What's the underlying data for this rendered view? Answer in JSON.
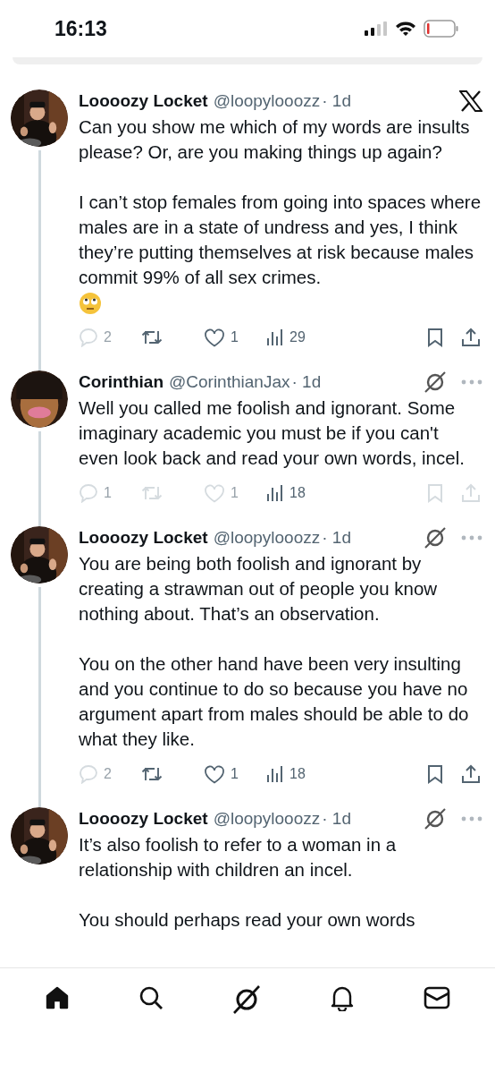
{
  "status_bar": {
    "time": "16:13"
  },
  "tweets": [
    {
      "name": "Loooozy Locket",
      "handle": "@loopylooozz",
      "time": "· 1d",
      "avatar": {
        "kind": "suit"
      },
      "badge": {
        "kind": "x_logo"
      },
      "more_menu": false,
      "paragraphs": [
        {
          "kind": "text",
          "text": "Can you show me which of my words are insults please? Or, are you making things up again?"
        },
        {
          "kind": "text",
          "text": "I can’t stop females from going into spaces where males are in a state of undress and yes, I think they’re putting themselves at risk because males commit 99% of all sex crimes."
        },
        {
          "kind": "emoji"
        }
      ],
      "actions": [
        {
          "kind": "reply",
          "count": "2",
          "disabled": true
        },
        {
          "kind": "repost",
          "disabled": false
        },
        {
          "kind": "like",
          "count": "1",
          "disabled": false
        },
        {
          "kind": "views",
          "count": "29",
          "disabled": false
        },
        {
          "kind": "bookmark",
          "disabled": false
        },
        {
          "kind": "share",
          "disabled": false
        }
      ]
    },
    {
      "name": "Corinthian",
      "handle": "@CorinthianJax",
      "time": "· 1d",
      "avatar": {
        "kind": "cartoon"
      },
      "badge": {
        "kind": "grok"
      },
      "more_menu": true,
      "paragraphs": [
        {
          "kind": "text",
          "text": "Well you called me foolish and ignorant. Some imaginary academic you must be if you can't even look back and read your own words, incel."
        }
      ],
      "actions": [
        {
          "kind": "reply",
          "count": "1",
          "disabled": true
        },
        {
          "kind": "repost",
          "disabled": true
        },
        {
          "kind": "like",
          "count": "1",
          "disabled": true
        },
        {
          "kind": "views",
          "count": "18",
          "disabled": false
        },
        {
          "kind": "bookmark",
          "disabled": true
        },
        {
          "kind": "share",
          "disabled": true
        }
      ]
    },
    {
      "name": "Loooozy Locket",
      "handle": "@loopylooozz",
      "time": "· 1d",
      "avatar": {
        "kind": "suit"
      },
      "badge": {
        "kind": "grok"
      },
      "more_menu": true,
      "paragraphs": [
        {
          "kind": "text",
          "text": "You are being both foolish and ignorant by creating a strawman out of people you know nothing about. That’s an observation."
        },
        {
          "kind": "text",
          "text": "You on the other hand have been very insulting and you continue to do so because you have no argument apart from males should be able to do what they like."
        }
      ],
      "actions": [
        {
          "kind": "reply",
          "count": "2",
          "disabled": true
        },
        {
          "kind": "repost",
          "disabled": false
        },
        {
          "kind": "like",
          "count": "1",
          "disabled": false
        },
        {
          "kind": "views",
          "count": "18",
          "disabled": false
        },
        {
          "kind": "bookmark",
          "disabled": false
        },
        {
          "kind": "share",
          "disabled": false
        }
      ]
    },
    {
      "name": "Loooozy Locket",
      "handle": "@loopylooozz",
      "time": "· 1d",
      "avatar": {
        "kind": "suit"
      },
      "badge": {
        "kind": "grok"
      },
      "more_menu": true,
      "paragraphs": [
        {
          "kind": "text",
          "text": "It’s also foolish to refer to a woman in a relationship with children an incel."
        },
        {
          "kind": "text",
          "text": "You should perhaps read your own words"
        }
      ]
    }
  ],
  "nav": [
    {
      "kind": "home",
      "selected": true
    },
    {
      "kind": "search",
      "selected": false
    },
    {
      "kind": "grok",
      "selected": false
    },
    {
      "kind": "notifications",
      "selected": false
    },
    {
      "kind": "messages",
      "selected": false
    }
  ]
}
